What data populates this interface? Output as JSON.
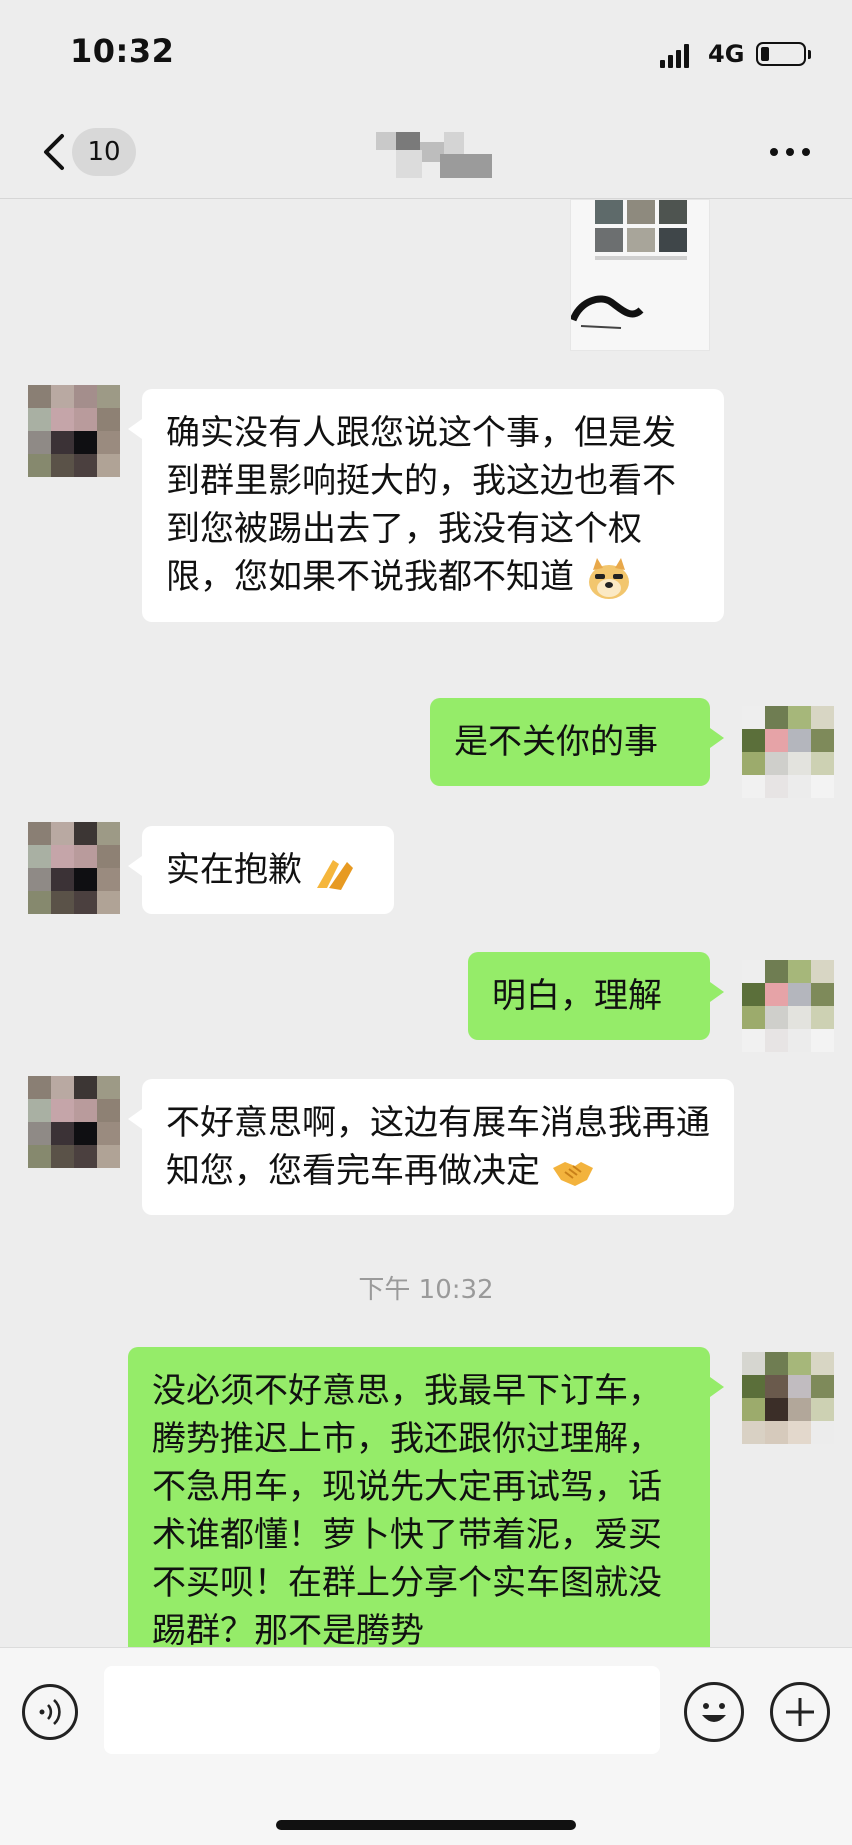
{
  "status_bar": {
    "time": "10:32",
    "network": "4G"
  },
  "nav": {
    "unread_count": "10",
    "title_obscured": true
  },
  "messages": [
    {
      "direction": "out",
      "kind": "image",
      "text": ""
    },
    {
      "direction": "in",
      "kind": "text",
      "text": "确实没有人跟您说这个事，但是发到群里影响挺大的，我这边也看不到您被踢出去了，我没有这个权限，您如果不说我都不知道",
      "emoji": "dog-face-emoji"
    },
    {
      "direction": "out",
      "kind": "text",
      "text": "是不关你的事"
    },
    {
      "direction": "in",
      "kind": "text",
      "text": "实在抱歉",
      "emoji": "praying-hands-emoji"
    },
    {
      "direction": "out",
      "kind": "text",
      "text": "明白，理解"
    },
    {
      "direction": "in",
      "kind": "text",
      "text": "不好意思啊，这边有展车消息我再通知您，您看完车再做决定",
      "emoji": "handshake-emoji"
    },
    {
      "direction": "out",
      "kind": "text",
      "text": "没必须不好意思，我最早下订车，腾势推迟上市，我还跟你过理解，不急用车，现说先大定再试驾，话术谁都懂！萝卜快了带着泥，爱买不买呗！在群上分享个实车图就没踢群？那不是腾势"
    }
  ],
  "timestamp": "下午 10:32",
  "input": {
    "placeholder": ""
  },
  "icons": [
    "back-chevron-icon",
    "more-icon",
    "voice-icon",
    "emoji-icon",
    "plus-icon"
  ],
  "colors": {
    "outgoing_bubble": "#95ec69",
    "incoming_bubble": "#ffffff",
    "background": "#ededed"
  }
}
